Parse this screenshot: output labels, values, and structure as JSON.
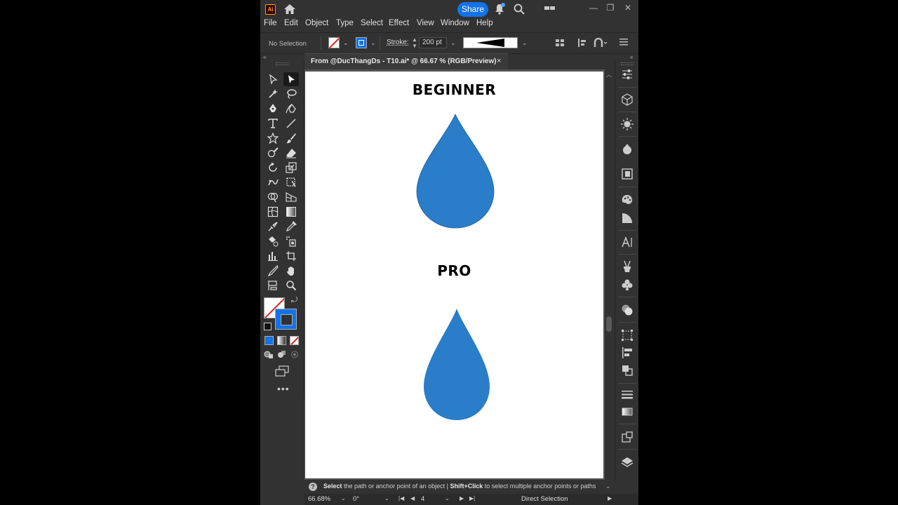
{
  "app": {
    "logo": "Ai",
    "share_label": "Share",
    "icons": [
      "home-icon",
      "bell-icon",
      "search-icon",
      "arrange-documents-icon",
      "minimize-icon",
      "restore-icon",
      "close-icon"
    ]
  },
  "menu": [
    "File",
    "Edit",
    "Object",
    "Type",
    "Select",
    "Effect",
    "View",
    "Window",
    "Help"
  ],
  "control_bar": {
    "selection_status": "No Selection",
    "stroke_label": "Stroke:",
    "stroke_weight": "200 pt"
  },
  "document": {
    "tab_title": "From @DucThangDs - T10.ai* @ 66.67 % (RGB/Preview)",
    "close_glyph": "×"
  },
  "artboard": {
    "heading_top": "BEGINNER",
    "heading_bottom": "PRO",
    "shape_color": "#2a7dc8"
  },
  "hint": {
    "action1": "Select",
    "text1": " the path or anchor point of an object  |  ",
    "action2": "Shift+Click",
    "text2": " to select multiple anchor points or paths"
  },
  "status": {
    "zoom": "66.68%",
    "rotation": "0°",
    "artboard_number": "4",
    "current_tool": "Direct Selection"
  },
  "colors": {
    "accent": "#1473e6",
    "ui_bg": "#323232",
    "stroke_color": "#1473e6"
  }
}
